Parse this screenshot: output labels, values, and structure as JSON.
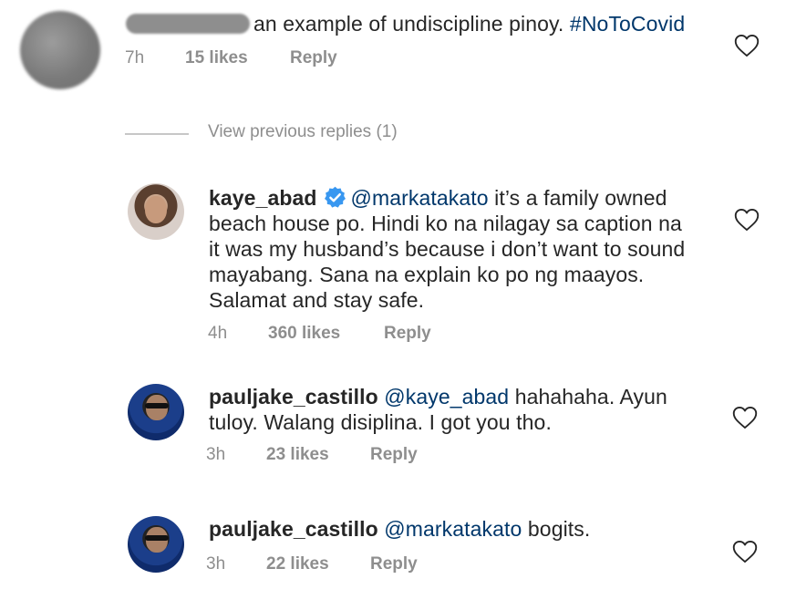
{
  "colors": {
    "text": "#262626",
    "muted": "#8e8e8e",
    "link": "#00376b",
    "verified": "#3897f0"
  },
  "comments": [
    {
      "id": "top",
      "text": "an example of undiscipline pinoy.",
      "hashtag": "#NoToCovid",
      "time": "7h",
      "likes": "15 likes",
      "reply": "Reply"
    }
  ],
  "view_previous": "View previous replies (1)",
  "replies": [
    {
      "username": "kaye_abad",
      "verified": true,
      "mention": "@markatakato",
      "lines": [
        "it’s a family owned",
        "beach house po. Hindi ko na nilagay sa caption na",
        "it was my husband’s because i don’t want to sound",
        "mayabang. Sana na explain ko po ng maayos.",
        "Salamat and stay safe."
      ],
      "time": "4h",
      "likes": "360 likes",
      "reply": "Reply"
    },
    {
      "username": "pauljake_castillo",
      "mention": "@kaye_abad",
      "lines": [
        "hahahaha. Ayun",
        "tuloy. Walang disiplina. I got you tho."
      ],
      "time": "3h",
      "likes": "23 likes",
      "reply": "Reply"
    },
    {
      "username": "pauljake_castillo",
      "mention": "@markatakato",
      "lines": [
        "bogits."
      ],
      "time": "3h",
      "likes": "22 likes",
      "reply": "Reply"
    }
  ],
  "icons": {
    "like": "heart-outline-icon",
    "verified": "verified-badge-icon"
  }
}
